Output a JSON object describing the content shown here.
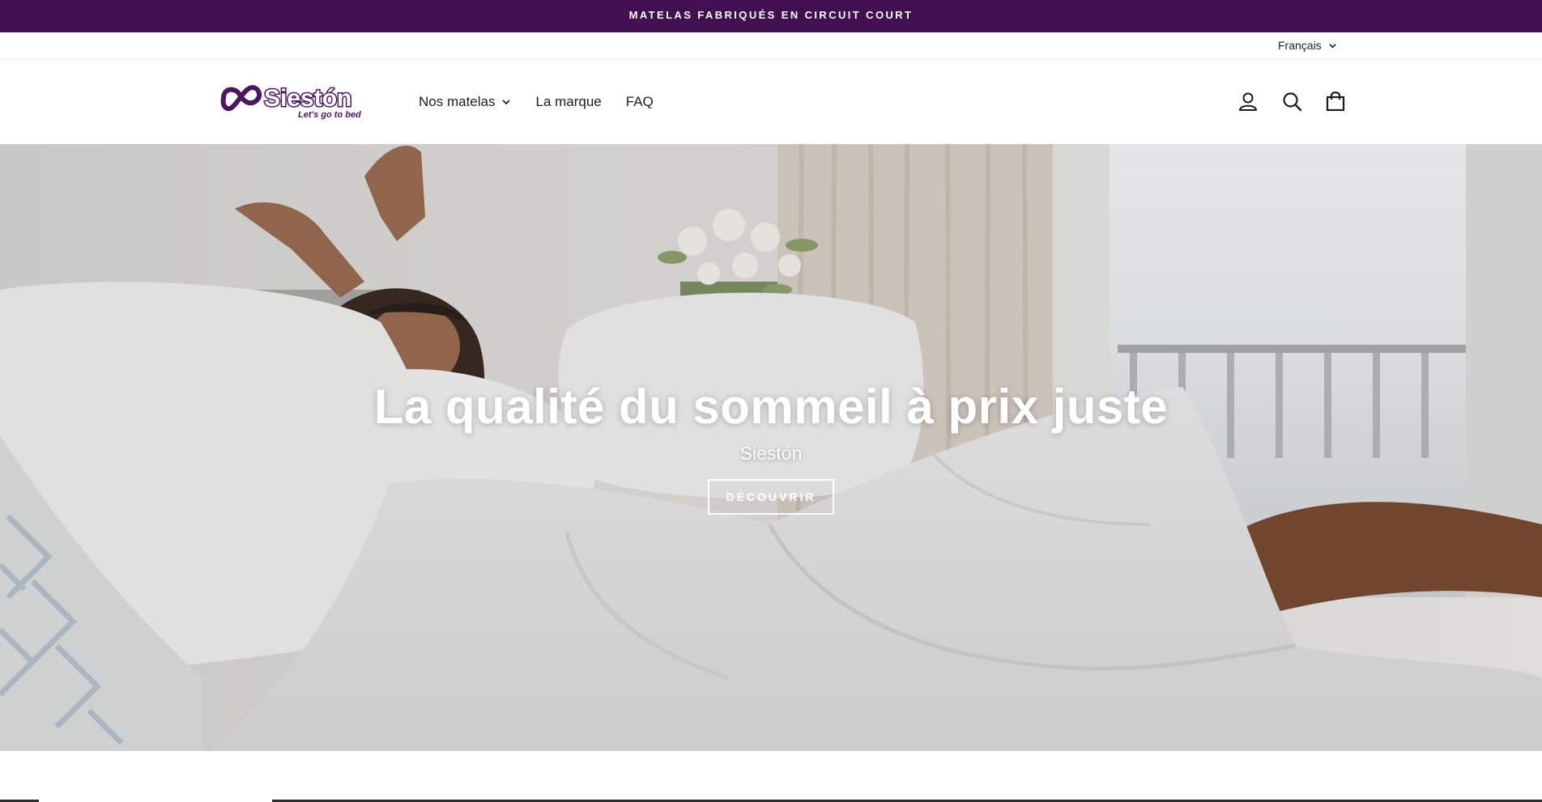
{
  "announcement": {
    "text": "MATELAS FABRIQUÉS EN CIRCUIT COURT",
    "bg_color": "#420f50"
  },
  "language": {
    "selected": "Français",
    "icon": "chevron-down-icon"
  },
  "header": {
    "logo": {
      "name": "Siestón",
      "tagline": "Let's go to bed",
      "color": "#4b1660"
    },
    "nav": [
      {
        "label": "Nos matelas",
        "has_dropdown": true
      },
      {
        "label": "La marque",
        "has_dropdown": false
      },
      {
        "label": "FAQ",
        "has_dropdown": false
      }
    ],
    "icons": [
      "account-icon",
      "search-icon",
      "cart-icon"
    ]
  },
  "hero": {
    "title": "La qualité du sommeil à prix juste",
    "subtitle": "Siestón",
    "button_label": "DÉCOUVRIR"
  }
}
